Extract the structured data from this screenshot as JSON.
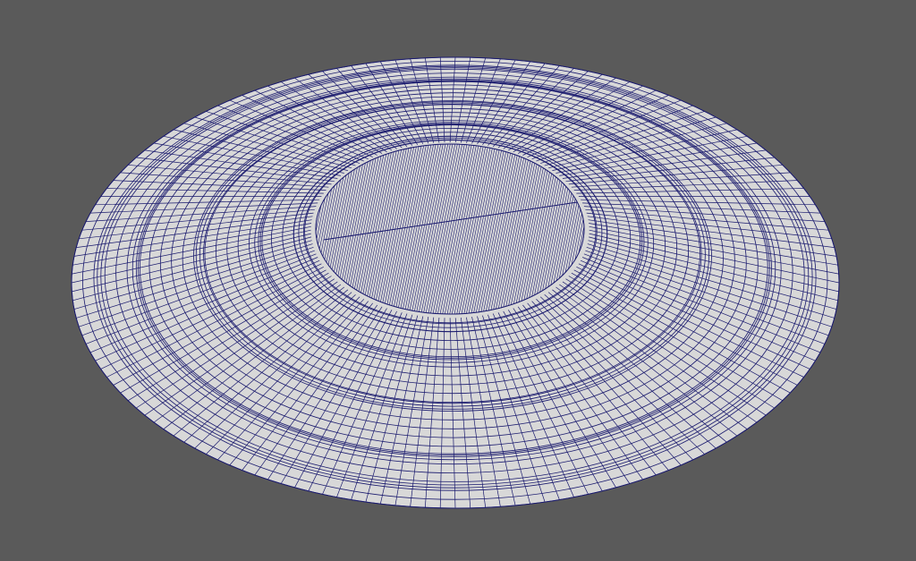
{
  "viewport": {
    "background_color": "#5a5a5a",
    "surface_color": "#d8d8d8",
    "wire_color": "#1a1a6e",
    "render_mode": "surface-with-edges"
  },
  "mesh": {
    "object": "annular-disk-mesh",
    "inner_region": "fine-triangulated-center",
    "outer_region": "structured-quad-rings",
    "radial_divisions_outer": 160,
    "radial_divisions_inner": 120
  }
}
